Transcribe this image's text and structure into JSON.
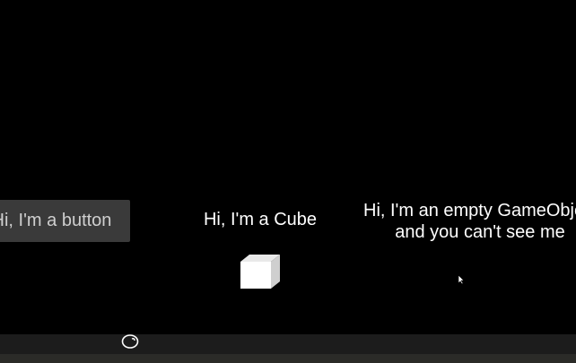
{
  "scene": {
    "button_label": "Hi, I'm a button",
    "cube_label": "Hi, I'm a Cube",
    "empty_object_label_line1": "Hi, I'm an empty GameObject",
    "empty_object_label_line2": "and you can't see me"
  },
  "icons": {
    "cube": "cube-icon",
    "cursor": "mouse-cursor-icon",
    "ball": "ball-icon"
  },
  "colors": {
    "background": "#000000",
    "button_bg": "#3a3a3a",
    "button_text": "#cfcfcf",
    "label_text": "#ffffff",
    "bottom_bar": "#1c1c1c"
  }
}
